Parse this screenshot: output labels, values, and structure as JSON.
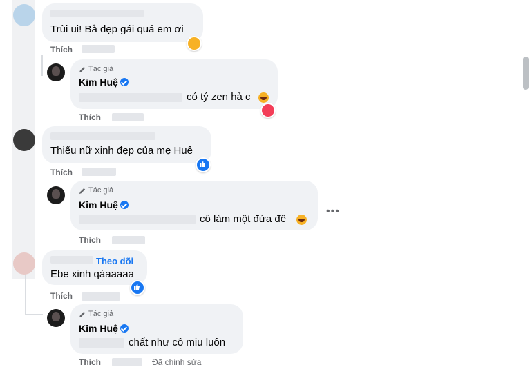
{
  "comments": [
    {
      "text": "Trùi ui! Bả đẹp gái quá em ơi",
      "action": "Thích"
    },
    {
      "text": "Thiếu nữ xinh đẹp của mẹ Huê",
      "action": "Thích"
    },
    {
      "follow": "Theo dõi",
      "text": "Ebe xinh qáaaaaa",
      "action": "Thích"
    }
  ],
  "replies": [
    {
      "author_tag": "Tác giả",
      "name": "Kim Huệ",
      "text": "có tý zen hả c",
      "action": "Thích"
    },
    {
      "author_tag": "Tác giả",
      "name": "Kim Huệ",
      "text": "cô làm một đứa đê",
      "action": "Thích"
    },
    {
      "author_tag": "Tác giả",
      "name": "Kim Huệ",
      "text": "chất như cô miu luôn",
      "action": "Thích",
      "edited": "Đã chỉnh sửa"
    }
  ],
  "more_options_glyph": "•••",
  "icons": [
    "pencil-icon",
    "verified-badge-icon",
    "like-reaction-icon",
    "heart-reaction-icon",
    "haha-reaction-icon",
    "more-options-icon"
  ]
}
